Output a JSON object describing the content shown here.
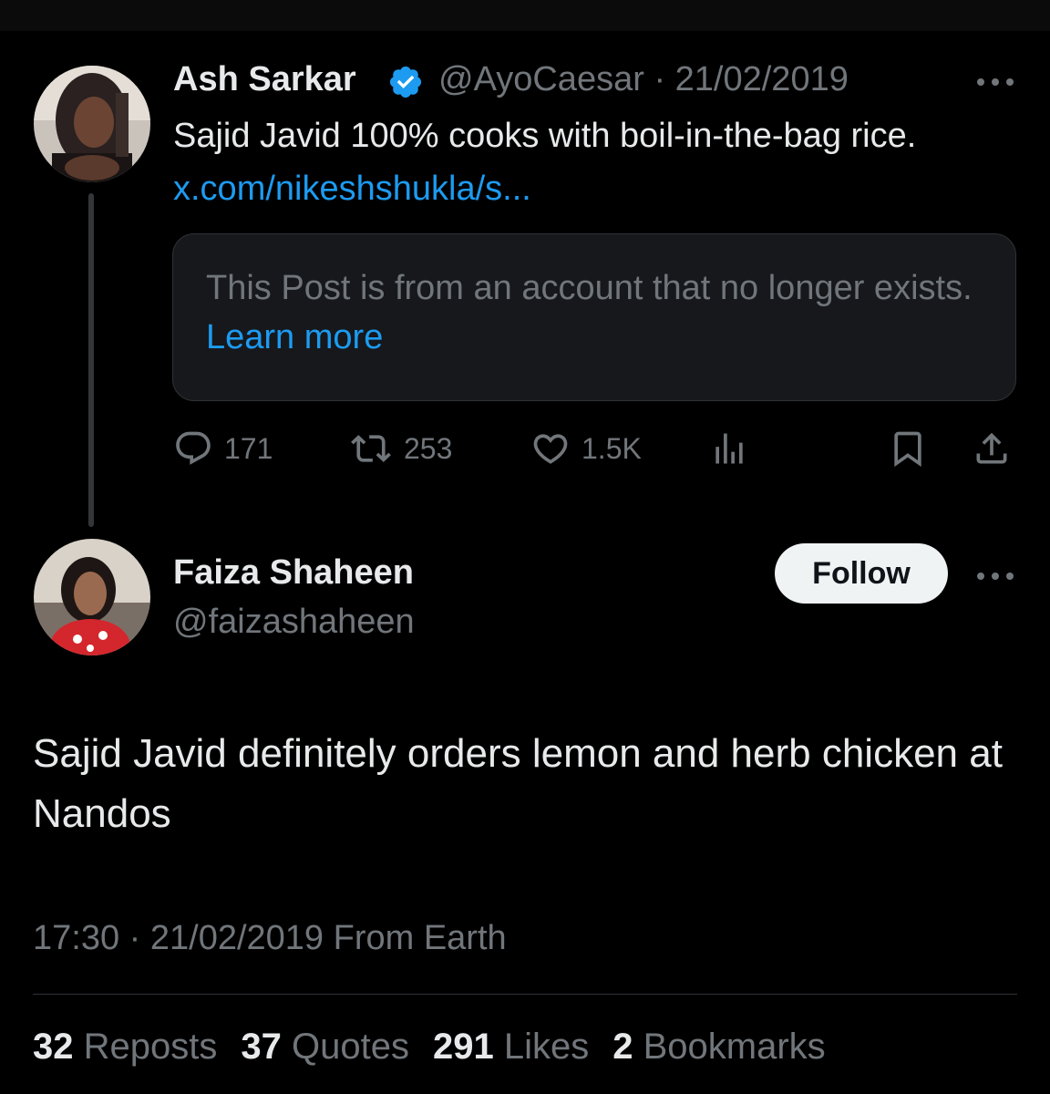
{
  "parent_tweet": {
    "author_name": "Ash Sarkar",
    "handle": "@AyoCaesar",
    "separator": "·",
    "date": "21/02/2019",
    "text": "Sajid Javid 100% cooks with boil-in-the-bag rice.",
    "link_text": "x.com/nikeshshukla/s...",
    "quote_card": {
      "message": "This Post is from an account that no longer exists.",
      "learn_more": "Learn more"
    },
    "actions": {
      "replies": "171",
      "reposts": "253",
      "likes": "1.5K"
    }
  },
  "main_tweet": {
    "author_name": "Faiza Shaheen",
    "handle": "@faizashaheen",
    "follow_label": "Follow",
    "text": "Sajid Javid definitely orders lemon and herb chicken at Nandos",
    "timestamp": "17:30 · 21/02/2019 From Earth",
    "stats": [
      {
        "count": "32",
        "label": "Reposts"
      },
      {
        "count": "37",
        "label": "Quotes"
      },
      {
        "count": "291",
        "label": "Likes"
      },
      {
        "count": "2",
        "label": "Bookmarks"
      }
    ]
  },
  "colors": {
    "background": "#000000",
    "text": "#e7e9ea",
    "muted": "#71767b",
    "link": "#1d9bf0",
    "verified": "#1d9bf0",
    "card_bg": "#16181c",
    "border": "#2f3336"
  },
  "icons": [
    "verified-badge-icon",
    "more-icon",
    "reply-icon",
    "repost-icon",
    "like-icon",
    "views-icon",
    "bookmark-icon",
    "share-icon"
  ]
}
